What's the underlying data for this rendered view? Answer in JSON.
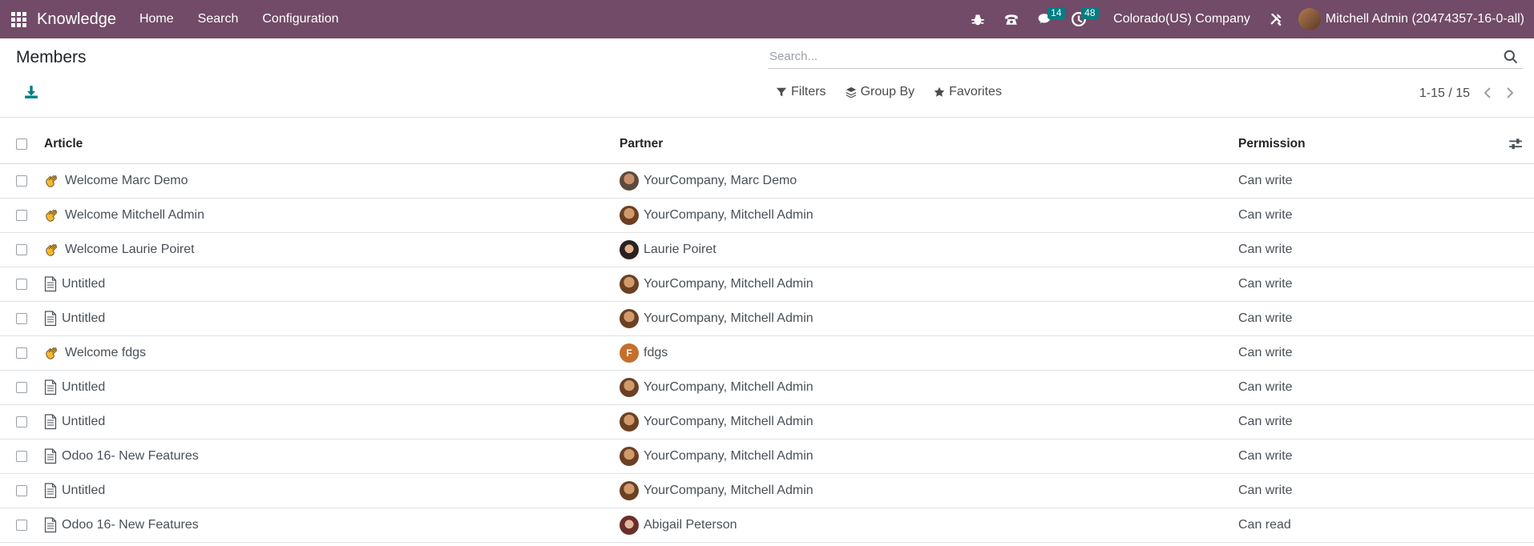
{
  "navbar": {
    "app_name": "Knowledge",
    "menu": [
      "Home",
      "Search",
      "Configuration"
    ],
    "messages_badge": "14",
    "activities_badge": "48",
    "company": "Colorado(US) Company",
    "user": "Mitchell Admin (20474357-16-0-all)",
    "bg_color": "#714b67"
  },
  "control_panel": {
    "title": "Members",
    "search_placeholder": "Search...",
    "filters_label": "Filters",
    "groupby_label": "Group By",
    "favorites_label": "Favorites",
    "pager": "1-15 / 15"
  },
  "table": {
    "headers": {
      "article": "Article",
      "partner": "Partner",
      "permission": "Permission"
    },
    "rows": [
      {
        "icon": "wave",
        "article": "Welcome Marc Demo",
        "avatar": "marc",
        "partner": "YourCompany, Marc Demo",
        "permission": "Can write"
      },
      {
        "icon": "wave",
        "article": "Welcome Mitchell Admin",
        "avatar": "mitchell",
        "partner": "YourCompany, Mitchell Admin",
        "permission": "Can write"
      },
      {
        "icon": "wave",
        "article": "Welcome Laurie Poiret",
        "avatar": "laurie",
        "partner": "Laurie Poiret",
        "permission": "Can write"
      },
      {
        "icon": "doc",
        "article": "Untitled",
        "avatar": "mitchell",
        "partner": "YourCompany, Mitchell Admin",
        "permission": "Can write"
      },
      {
        "icon": "doc",
        "article": "Untitled",
        "avatar": "mitchell",
        "partner": "YourCompany, Mitchell Admin",
        "permission": "Can write"
      },
      {
        "icon": "wave",
        "article": "Welcome fdgs",
        "avatar": "letter",
        "avatar_letter": "F",
        "partner": "fdgs",
        "permission": "Can write"
      },
      {
        "icon": "doc",
        "article": "Untitled",
        "avatar": "mitchell",
        "partner": "YourCompany, Mitchell Admin",
        "permission": "Can write"
      },
      {
        "icon": "doc",
        "article": "Untitled",
        "avatar": "mitchell",
        "partner": "YourCompany, Mitchell Admin",
        "permission": "Can write"
      },
      {
        "icon": "doc",
        "article": "Odoo 16- New Features",
        "avatar": "mitchell",
        "partner": "YourCompany, Mitchell Admin",
        "permission": "Can write"
      },
      {
        "icon": "doc",
        "article": "Untitled",
        "avatar": "mitchell",
        "partner": "YourCompany, Mitchell Admin",
        "permission": "Can write"
      },
      {
        "icon": "doc",
        "article": "Odoo 16- New Features",
        "avatar": "abigail",
        "partner": "Abigail Peterson",
        "permission": "Can read"
      }
    ]
  }
}
